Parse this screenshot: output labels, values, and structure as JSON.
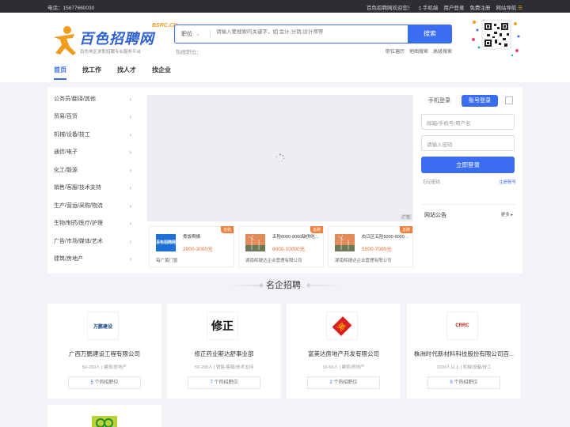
{
  "topbar": {
    "phone": "电话：15677660030",
    "welcome": "百色招聘网欢迎您！",
    "mobile": "手机端",
    "login": "用户登录",
    "register": "免费注册",
    "sitenav": "网站导航"
  },
  "logo": {
    "cn": "百色招聘网",
    "en": "BSRC.CN",
    "tagline": "百色地区求职招聘专业服务平台"
  },
  "search": {
    "select_label": "职位",
    "placeholder": "请输入要搜索的关键字，如 会计,分销,设计师等",
    "button": "搜索",
    "hot_label": "热搜职位：",
    "quick_links": [
      "职位遍历",
      "地图搜索",
      "高级搜索"
    ]
  },
  "nav": [
    "首页",
    "找工作",
    "找人才",
    "找企业"
  ],
  "categories": [
    "公务员/翻译/其他",
    "贸易/百货",
    "机械/设备/技工",
    "通信/电子",
    "化工/能源",
    "销售/客服/技术支持",
    "生产/营运/采购/物流",
    "生物/制药/医疗/护理",
    "广告/市场/媒体/艺术",
    "建筑/房地产"
  ],
  "banner": {
    "ad_tag": "广告"
  },
  "job_cards": [
    {
      "title": "煮饭啊姨",
      "salary": "2000-3000元",
      "company": "每广黄门窗",
      "badge": "急聘"
    },
    {
      "title": "五险6000-8000缺供吃...",
      "salary": "6000-10000元",
      "company": "湖南辉捷达企业管理有限公司",
      "badge": "急聘"
    },
    {
      "title": "右江区五险5000-6000...",
      "salary": "5000-7000元",
      "company": "湖南辉捷达企业管理有限公司",
      "badge": "急聘"
    }
  ],
  "login": {
    "tab_phone": "手机登录",
    "tab_account": "账号登录",
    "user_placeholder": "邮箱/手机号/用户名",
    "pass_placeholder": "请输入密码",
    "button": "立即登录",
    "forgot": "忘记密码",
    "register": "注册账号"
  },
  "notice": {
    "title": "网站公告",
    "more": "更多"
  },
  "section_title": "名企招聘",
  "companies": [
    {
      "name": "广西万鹏建设工程有限公司",
      "size": "50-200人",
      "industry": "建筑/房地产",
      "hot_count": "5",
      "hot_suffix": "个热招职位",
      "logo_text": "万鹏建设"
    },
    {
      "name": "修正药业斯达舒事业部",
      "size": "50-200人",
      "industry": "销售/客服/技术支持",
      "hot_count": "7",
      "hot_suffix": "个热招职位",
      "logo_text": "修正"
    },
    {
      "name": "富美达房地产开发有限公司",
      "size": "10-50人",
      "industry": "建筑/房地产",
      "hot_count": "2",
      "hot_suffix": "个热招职位",
      "logo_text": "美"
    },
    {
      "name": "株洲时代新材料科技股份有限公司百...",
      "size": "1000人以上",
      "industry": "机械/设备/技工",
      "hot_count": "6",
      "hot_suffix": "个热招职位",
      "logo_text": "CRRC"
    }
  ],
  "colors": {
    "primary": "#3a6df0",
    "accent": "#f2803a",
    "salary": "#f26b2d",
    "topbar": "#2c2e33"
  }
}
